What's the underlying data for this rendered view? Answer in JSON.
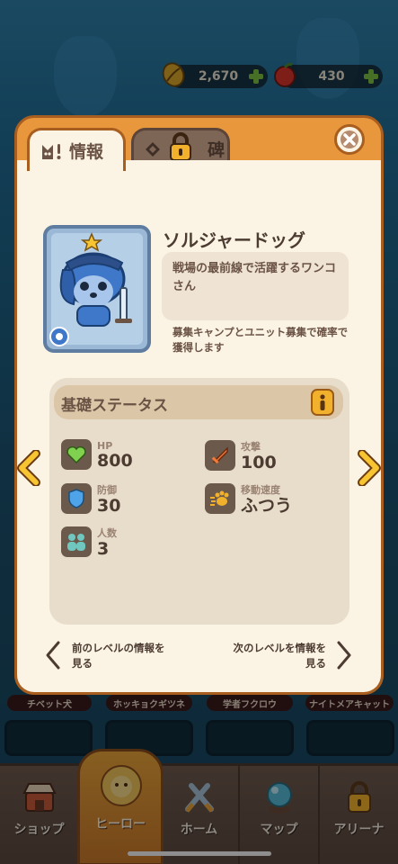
{
  "currencies": [
    {
      "name": "gold",
      "amount": "2,670",
      "icon": "leaf-coin-icon"
    },
    {
      "name": "apple",
      "amount": "430",
      "icon": "apple-icon"
    }
  ],
  "tabs": [
    {
      "label": "情報",
      "active": true
    },
    {
      "label": "碑",
      "locked": true
    }
  ],
  "hero": {
    "name": "ソルジャードッグ",
    "description": "戦場の最前線で活躍するワンコさん",
    "source": "募集キャンプとユニット募集で確率で獲得します"
  },
  "stats": {
    "title": "基礎ステータス",
    "items": [
      {
        "label": "HP",
        "value": "800",
        "icon": "heart-icon"
      },
      {
        "label": "攻撃",
        "value": "100",
        "icon": "sword-icon"
      },
      {
        "label": "防御",
        "value": "30",
        "icon": "shield-icon"
      },
      {
        "label": "移動速度",
        "value": "ふつう",
        "icon": "paw-icon"
      },
      {
        "label": "人数",
        "value": "3",
        "icon": "people-icon"
      }
    ]
  },
  "footer": {
    "prev_line1": "前のレベルの情報を",
    "prev_line2": "見る",
    "next_line1": "次のレベルを情報を",
    "next_line2": "見る"
  },
  "background_names": [
    "チベット犬",
    "ホッキョクギツネ",
    "学者フクロウ",
    "ナイトメアキャット"
  ],
  "nav": [
    {
      "label": "ショップ"
    },
    {
      "label": "ヒーロー",
      "active": true
    },
    {
      "label": "ホーム"
    },
    {
      "label": "マップ"
    },
    {
      "label": "アリーナ",
      "locked": true
    }
  ],
  "colors": {
    "modal_orange": "#e9973c",
    "modal_cream": "#fbf3e4",
    "text_brown": "#4c3b31",
    "accent_yellow": "#f2b12d"
  }
}
